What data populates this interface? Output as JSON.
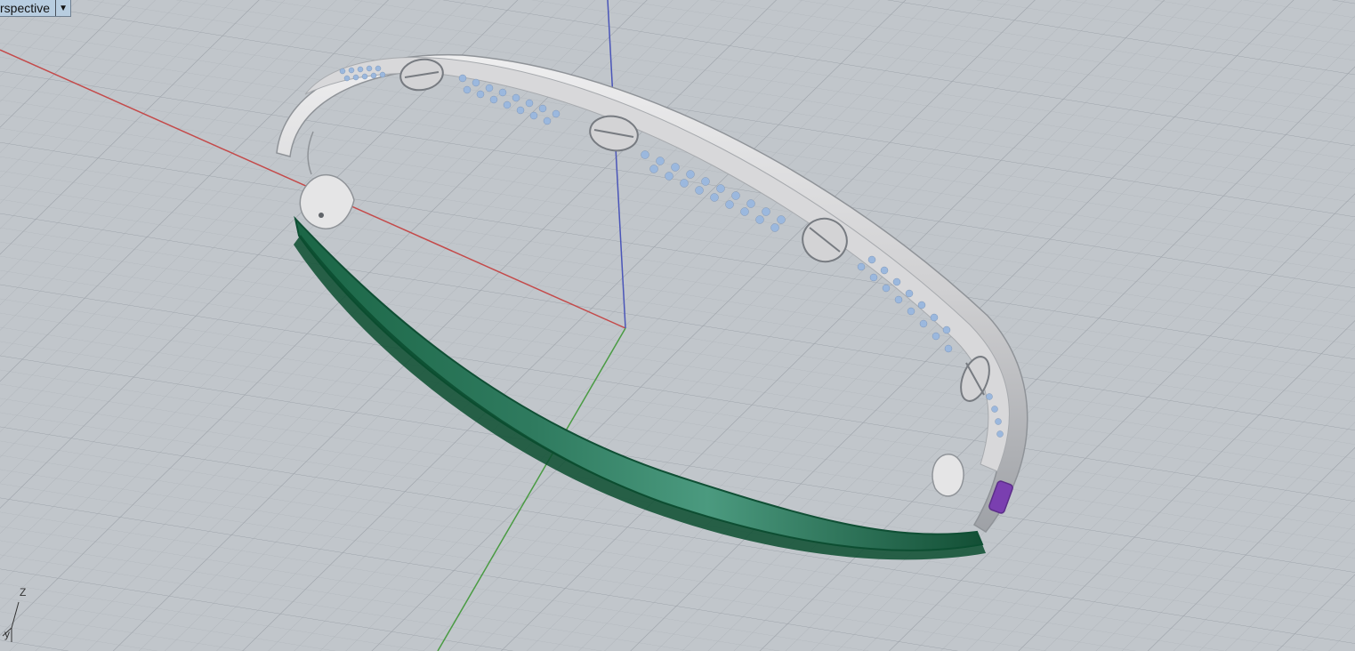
{
  "viewport": {
    "title": "rspective",
    "menu_icon": "triangle-down-icon",
    "background_color": "#c1c6cb",
    "grid_color": "#aeb3b9"
  },
  "axis_widget": {
    "z_label": "Z",
    "y_label": "y"
  },
  "model": {
    "metal_color": "#cfcfd1",
    "gem_color": "#9bb8de",
    "selection_color": "#2f7b5f",
    "axis_x_color": "#c44a4a",
    "axis_y_color": "#4a9b43",
    "axis_z_color": "#4a55b8",
    "screw_accent_color": "#7a3fb0"
  }
}
